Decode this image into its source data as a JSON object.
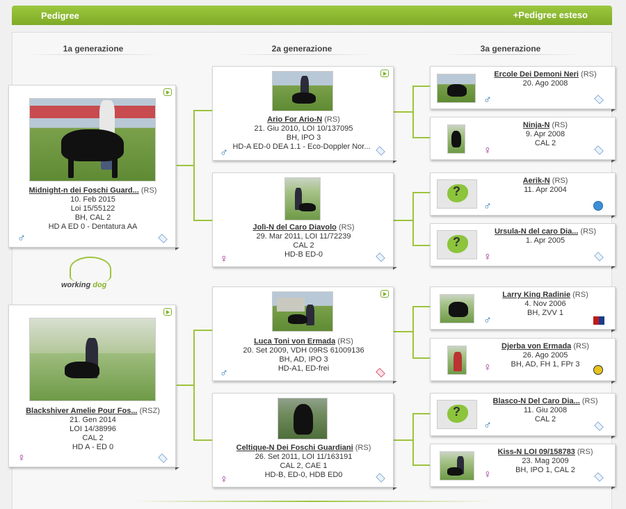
{
  "header": {
    "title": "Pedigree",
    "extended_link": "+Pedigree esteso"
  },
  "generations": [
    "1a generazione",
    "2a generazione",
    "3a generazione"
  ],
  "colors": {
    "accent": "#8dbb34",
    "male": "#1a6fb0",
    "female": "#9a2b8e"
  },
  "gen1": [
    {
      "name": "Midnight-n dei Foschi Guard...",
      "reg": "(RS)",
      "lines": [
        "10. Feb 2015",
        "Loi 15/55122",
        "BH, CAL 2",
        "HD A ED 0 - Dentatura AA"
      ],
      "gender": "♂",
      "gender_icon": "male-icon",
      "badge": "registry-badge-icon",
      "video": true
    },
    {
      "name": "Blackshiver Amelie Pour Fos...",
      "reg": "(RSZ)",
      "lines": [
        "21. Gen 2014",
        "LOI 14/38996",
        "CAL 2",
        "HD A - ED 0"
      ],
      "gender": "♀",
      "gender_icon": "female-icon",
      "badge": "registry-badge-icon",
      "video": true
    }
  ],
  "gen2": [
    {
      "name": "Ario For Ario-N",
      "reg": "(RS)",
      "lines": [
        "21. Giu 2010, LOI 10/137095",
        "BH, IPO 3",
        "HD-A ED-0 DEA 1.1 - Eco-Doppler Nor..."
      ],
      "gender": "♂",
      "gender_icon": "male-icon",
      "video": true
    },
    {
      "name": "Jolì-N del Caro Diavolo",
      "reg": "(RS)",
      "lines": [
        "29. Mar 2011, LOI 11/72239",
        "CAL 2",
        "HD-B ED-0"
      ],
      "gender": "♀",
      "gender_icon": "female-icon",
      "video": false
    },
    {
      "name": "Luca Toni von Ermada",
      "reg": "(RS)",
      "lines": [
        "20. Set 2009, VDH 09RS 61009136",
        "BH, AD, IPO 3",
        "HD-A1, ED-frei"
      ],
      "gender": "♂",
      "gender_icon": "male-icon",
      "video": true
    },
    {
      "name": "Celtique-N Dei Foschi Guardiani",
      "reg": "(RS)",
      "lines": [
        "26. Set 2011, LOI 11/163191",
        "CAL 2, CAE 1",
        "HD-B, ED-0, HDB ED0"
      ],
      "gender": "♀",
      "gender_icon": "female-icon",
      "video": false
    }
  ],
  "gen3": [
    {
      "name": "Ercole Dei Demoni Neri",
      "reg": "(RS)",
      "lines": [
        "20. Ago 2008"
      ],
      "gender": "♂"
    },
    {
      "name": "Ninja-N",
      "reg": "(RS)",
      "lines": [
        "9. Apr 2008",
        "CAL 2"
      ],
      "gender": "♀"
    },
    {
      "name": "Aerik-N",
      "reg": "(RS)",
      "lines": [
        "11. Apr 2004"
      ],
      "gender": "♂"
    },
    {
      "name": "Ursula-N del caro Dia...",
      "reg": "(RS)",
      "lines": [
        "1. Apr 2005"
      ],
      "gender": "♀"
    },
    {
      "name": "Larry King Radinie",
      "reg": "(RS)",
      "lines": [
        "4. Nov 2006",
        "BH, ZVV 1"
      ],
      "gender": "♂"
    },
    {
      "name": "Djerba von Ermada",
      "reg": "(RS)",
      "lines": [
        "26. Ago 2005",
        "BH, AD, FH 1, FPr 3"
      ],
      "gender": "♀"
    },
    {
      "name": "Blasco-N Del Caro Dia...",
      "reg": "(RS)",
      "lines": [
        "11. Giu 2008",
        "CAL 2"
      ],
      "gender": "♂"
    },
    {
      "name": "Kiss-N LOI 09/158783",
      "reg": "(RS)",
      "lines": [
        "23. Mag 2009",
        "BH, IPO 1, CAL 2"
      ],
      "gender": "♀"
    }
  ],
  "logo": {
    "word1": "working",
    "word2": "dog"
  }
}
